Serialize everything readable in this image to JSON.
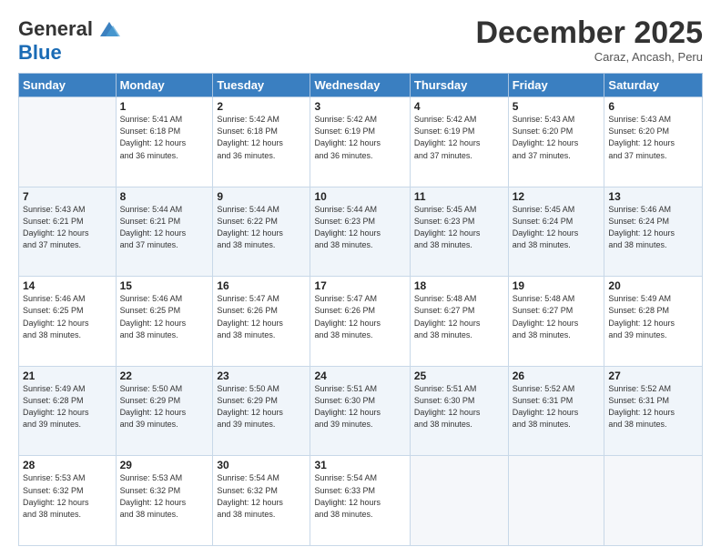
{
  "header": {
    "logo_general": "General",
    "logo_blue": "Blue",
    "month_title": "December 2025",
    "location": "Caraz, Ancash, Peru"
  },
  "weekdays": [
    "Sunday",
    "Monday",
    "Tuesday",
    "Wednesday",
    "Thursday",
    "Friday",
    "Saturday"
  ],
  "weeks": [
    [
      {
        "day": "",
        "info": ""
      },
      {
        "day": "1",
        "info": "Sunrise: 5:41 AM\nSunset: 6:18 PM\nDaylight: 12 hours\nand 36 minutes."
      },
      {
        "day": "2",
        "info": "Sunrise: 5:42 AM\nSunset: 6:18 PM\nDaylight: 12 hours\nand 36 minutes."
      },
      {
        "day": "3",
        "info": "Sunrise: 5:42 AM\nSunset: 6:19 PM\nDaylight: 12 hours\nand 36 minutes."
      },
      {
        "day": "4",
        "info": "Sunrise: 5:42 AM\nSunset: 6:19 PM\nDaylight: 12 hours\nand 37 minutes."
      },
      {
        "day": "5",
        "info": "Sunrise: 5:43 AM\nSunset: 6:20 PM\nDaylight: 12 hours\nand 37 minutes."
      },
      {
        "day": "6",
        "info": "Sunrise: 5:43 AM\nSunset: 6:20 PM\nDaylight: 12 hours\nand 37 minutes."
      }
    ],
    [
      {
        "day": "7",
        "info": "Sunrise: 5:43 AM\nSunset: 6:21 PM\nDaylight: 12 hours\nand 37 minutes."
      },
      {
        "day": "8",
        "info": "Sunrise: 5:44 AM\nSunset: 6:21 PM\nDaylight: 12 hours\nand 37 minutes."
      },
      {
        "day": "9",
        "info": "Sunrise: 5:44 AM\nSunset: 6:22 PM\nDaylight: 12 hours\nand 38 minutes."
      },
      {
        "day": "10",
        "info": "Sunrise: 5:44 AM\nSunset: 6:23 PM\nDaylight: 12 hours\nand 38 minutes."
      },
      {
        "day": "11",
        "info": "Sunrise: 5:45 AM\nSunset: 6:23 PM\nDaylight: 12 hours\nand 38 minutes."
      },
      {
        "day": "12",
        "info": "Sunrise: 5:45 AM\nSunset: 6:24 PM\nDaylight: 12 hours\nand 38 minutes."
      },
      {
        "day": "13",
        "info": "Sunrise: 5:46 AM\nSunset: 6:24 PM\nDaylight: 12 hours\nand 38 minutes."
      }
    ],
    [
      {
        "day": "14",
        "info": "Sunrise: 5:46 AM\nSunset: 6:25 PM\nDaylight: 12 hours\nand 38 minutes."
      },
      {
        "day": "15",
        "info": "Sunrise: 5:46 AM\nSunset: 6:25 PM\nDaylight: 12 hours\nand 38 minutes."
      },
      {
        "day": "16",
        "info": "Sunrise: 5:47 AM\nSunset: 6:26 PM\nDaylight: 12 hours\nand 38 minutes."
      },
      {
        "day": "17",
        "info": "Sunrise: 5:47 AM\nSunset: 6:26 PM\nDaylight: 12 hours\nand 38 minutes."
      },
      {
        "day": "18",
        "info": "Sunrise: 5:48 AM\nSunset: 6:27 PM\nDaylight: 12 hours\nand 38 minutes."
      },
      {
        "day": "19",
        "info": "Sunrise: 5:48 AM\nSunset: 6:27 PM\nDaylight: 12 hours\nand 38 minutes."
      },
      {
        "day": "20",
        "info": "Sunrise: 5:49 AM\nSunset: 6:28 PM\nDaylight: 12 hours\nand 39 minutes."
      }
    ],
    [
      {
        "day": "21",
        "info": "Sunrise: 5:49 AM\nSunset: 6:28 PM\nDaylight: 12 hours\nand 39 minutes."
      },
      {
        "day": "22",
        "info": "Sunrise: 5:50 AM\nSunset: 6:29 PM\nDaylight: 12 hours\nand 39 minutes."
      },
      {
        "day": "23",
        "info": "Sunrise: 5:50 AM\nSunset: 6:29 PM\nDaylight: 12 hours\nand 39 minutes."
      },
      {
        "day": "24",
        "info": "Sunrise: 5:51 AM\nSunset: 6:30 PM\nDaylight: 12 hours\nand 39 minutes."
      },
      {
        "day": "25",
        "info": "Sunrise: 5:51 AM\nSunset: 6:30 PM\nDaylight: 12 hours\nand 38 minutes."
      },
      {
        "day": "26",
        "info": "Sunrise: 5:52 AM\nSunset: 6:31 PM\nDaylight: 12 hours\nand 38 minutes."
      },
      {
        "day": "27",
        "info": "Sunrise: 5:52 AM\nSunset: 6:31 PM\nDaylight: 12 hours\nand 38 minutes."
      }
    ],
    [
      {
        "day": "28",
        "info": "Sunrise: 5:53 AM\nSunset: 6:32 PM\nDaylight: 12 hours\nand 38 minutes."
      },
      {
        "day": "29",
        "info": "Sunrise: 5:53 AM\nSunset: 6:32 PM\nDaylight: 12 hours\nand 38 minutes."
      },
      {
        "day": "30",
        "info": "Sunrise: 5:54 AM\nSunset: 6:32 PM\nDaylight: 12 hours\nand 38 minutes."
      },
      {
        "day": "31",
        "info": "Sunrise: 5:54 AM\nSunset: 6:33 PM\nDaylight: 12 hours\nand 38 minutes."
      },
      {
        "day": "",
        "info": ""
      },
      {
        "day": "",
        "info": ""
      },
      {
        "day": "",
        "info": ""
      }
    ]
  ]
}
